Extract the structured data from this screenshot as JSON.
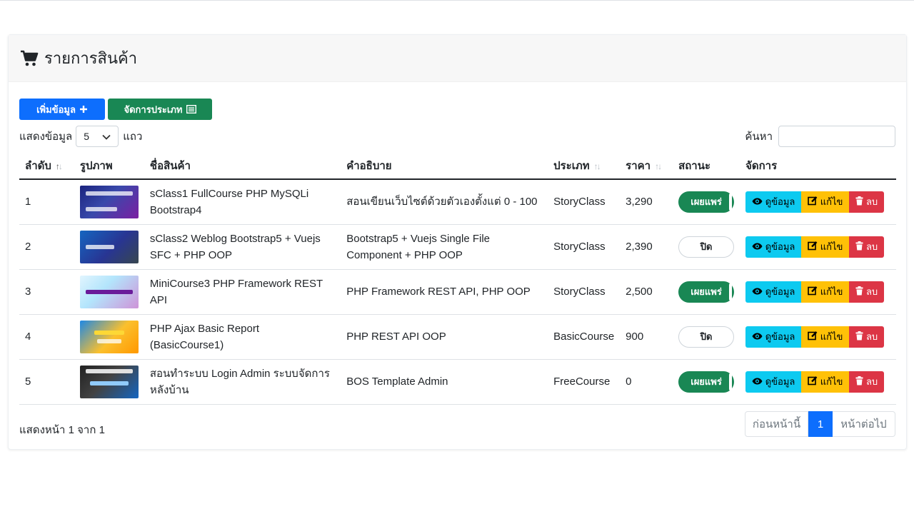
{
  "header": {
    "title": "รายการสินค้า",
    "icon": "cart-icon"
  },
  "toolbar": {
    "add_label": "เพิ่มข้อมูล",
    "manage_category_label": "จัดการประเภท"
  },
  "length_menu": {
    "prefix": "แสดงข้อมูล",
    "value": "5",
    "suffix": "แถว"
  },
  "search": {
    "label": "ค้นหา",
    "value": ""
  },
  "table": {
    "columns": [
      "ลำดับ",
      "รูปภาพ",
      "ชื่อสินค้า",
      "คำอธิบาย",
      "ประเภท",
      "ราคา",
      "สถานะ",
      "จัดการ"
    ],
    "rows": [
      {
        "no": "1",
        "name": "sClass1 FullCourse PHP MySQLi Bootstrap4",
        "desc": "สอนเขียนเว็บไซต์ด้วยตัวเองตั้งแต่ 0 - 100",
        "type": "StoryClass",
        "price": "3,290",
        "status": "เผยแพร่"
      },
      {
        "no": "2",
        "name": "sClass2 Weblog Bootstrap5 + Vuejs SFC + PHP OOP",
        "desc": "Bootstrap5 + Vuejs Single File Component + PHP OOP",
        "type": "StoryClass",
        "price": "2,390",
        "status": "ปิด"
      },
      {
        "no": "3",
        "name": "MiniCourse3 PHP Framework REST API",
        "desc": "PHP Framework REST API, PHP OOP",
        "type": "StoryClass",
        "price": "2,500",
        "status": "เผยแพร่"
      },
      {
        "no": "4",
        "name": "PHP Ajax Basic Report (BasicCourse1)",
        "desc": "PHP REST API OOP",
        "type": "BasicCourse",
        "price": "900",
        "status": "ปิด"
      },
      {
        "no": "5",
        "name": "สอนทำระบบ Login Admin ระบบจัดการหลังบ้าน",
        "desc": "BOS Template Admin",
        "type": "FreeCourse",
        "price": "0",
        "status": "เผยแพร่"
      }
    ],
    "actions": {
      "view": "ดูข้อมูล",
      "edit": "แก้ไข",
      "delete": "ลบ"
    }
  },
  "footer": {
    "info": "แสดงหน้า 1 จาก 1",
    "prev": "ก่อนหน้านี้",
    "page": "1",
    "next": "หน้าต่อไป"
  },
  "colors": {
    "primary": "#0d6efd",
    "success": "#198754",
    "info": "#0dcaf0",
    "warning": "#ffc107",
    "danger": "#dc3545"
  }
}
